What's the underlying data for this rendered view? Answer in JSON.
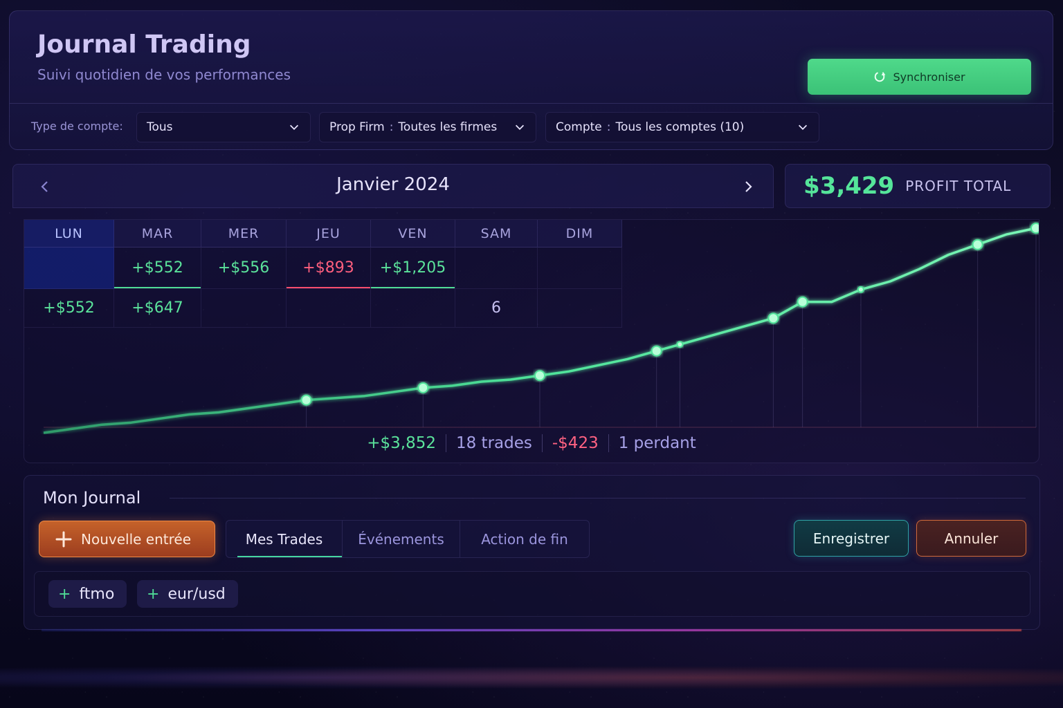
{
  "header": {
    "title": "Journal Trading",
    "subtitle": "Suivi quotidien de vos performances",
    "sync_label": "Synchroniser"
  },
  "filters": {
    "account_type_label": "Type de compte:",
    "account_type_value": "Tous",
    "prop_firm_prefix": "Prop Firm",
    "prop_firm_value": "Toutes les firmes",
    "account_prefix": "Compte",
    "account_value": "Tous les comptes (10)"
  },
  "calendar": {
    "month": "Janvier 2024",
    "days": [
      "LUN",
      "MAR",
      "MER",
      "JEU",
      "VEN",
      "SAM",
      "DIM"
    ],
    "row1": [
      "",
      "+$552",
      "+$556",
      "+$893",
      "+$1,205",
      "",
      ""
    ],
    "row2": [
      "+$552",
      "+$647",
      "",
      "",
      "",
      "6",
      ""
    ]
  },
  "profit": {
    "value": "$3,429",
    "label": "PROFIT TOTAL"
  },
  "chart_data": {
    "type": "line",
    "series": [
      {
        "values": [
          0,
          2,
          4,
          5,
          7,
          9,
          10,
          12,
          14,
          16,
          17,
          18,
          20,
          22,
          23,
          25,
          26,
          28,
          30,
          33,
          36,
          40,
          44,
          48,
          52,
          56,
          64,
          64,
          70,
          74,
          80,
          87,
          92,
          97,
          100
        ]
      }
    ],
    "markers_at": [
      9,
      13,
      17,
      21,
      21.8,
      25,
      26,
      28,
      32,
      34
    ],
    "color": "#4fe39a"
  },
  "stats": {
    "profit": "+$3,852",
    "trades": "18 trades",
    "loss": "-$423",
    "losers": "1 perdant"
  },
  "journal": {
    "title": "Mon Journal",
    "new_entry_label": "Nouvelle entrée",
    "tabs": [
      "Mes Trades",
      "Événements",
      "Action de fin"
    ],
    "save_label": "Enregistrer",
    "cancel_label": "Annuler",
    "tags": [
      "ftmo",
      "eur/usd"
    ]
  },
  "colors": {
    "positive": "#5be39b",
    "negative": "#ff5f7e",
    "accent_green": "#4fd98a",
    "accent_orange": "#c5622a"
  }
}
